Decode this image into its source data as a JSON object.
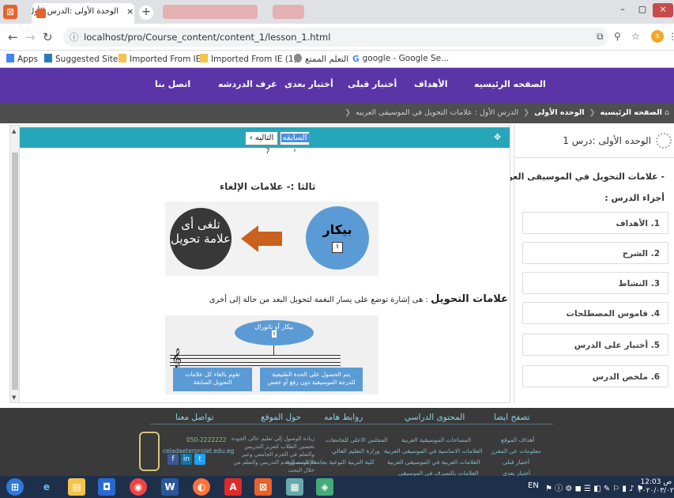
{
  "browser": {
    "tab_title": "الوحدة الأولى :الدرس الأول",
    "url": "localhost/pro/Course_content/content_1/lesson_1.html",
    "bookmarks": [
      "Apps",
      "Suggested Sites",
      "Imported From IE",
      "Imported From IE (1)",
      "التعلم الممتع",
      "google - Google Se..."
    ]
  },
  "site_nav": {
    "items": [
      "الصفحه الرئيسيه",
      "الأهداف",
      "أختبار قبلى",
      "أختبار بعدى",
      "غرف الدردشه",
      "اتصل بنا"
    ]
  },
  "breadcrumb": {
    "home": "الصفحه الرئيسيه",
    "unit": "الوحده الأولى",
    "lesson": "الدرس الأول : علامات التحويل في الموسيقى العربيه"
  },
  "sidebar": {
    "title": "الوحده الأولى :درس 1",
    "lesson_name": "- علامات التحويل في الموسيقى العربية",
    "parts_label": "أجزاء الدرس :",
    "menu": [
      "1. الأهداف",
      "2. الشرح",
      "3. النشاط",
      "4. قاموس المصطلحات",
      "5. أختبار على الدرس",
      "6. ملخص الدرس"
    ]
  },
  "content": {
    "prev_label": "السابقه",
    "next_label": "التاليه",
    "page_number": "7",
    "heading": "ثالثا :- علامات الإلغاء",
    "fig1": {
      "left_text": "تلغى أى علامة تحويل",
      "right_text": "بيكار",
      "natural_sign": "♮"
    },
    "definition_term": "علامات التحويل",
    "definition_text": " : هى إشارة توضع على يسار النغمة لتحويل البعد من حالة إلى أخرى",
    "fig2": {
      "ellipse_text": "بيكار أو ناتورال",
      "box_left": "تقوم بالغاء كل علامات التحويل السابقة",
      "box_right": "يتم الحصول على الحدة الطبيعية للدرجة الموسيقية دون رفع أو خفض"
    }
  },
  "footer": {
    "titles": [
      "تصفح ايضا",
      "المحتوى الدراسي",
      "روابط هامه",
      "حول الموقع",
      "تواصل معنا"
    ],
    "browse_links": [
      "أهداف الموقع",
      "معلومات عن المقرر",
      "أختبار قبلى",
      "أختبار بعدى"
    ],
    "content_links": [
      "المساحات الموسيقية العربية",
      "العلامات الاساسية في الموسيقى العربية",
      "العلامات العربية في الموسيقى العربية",
      "العلامات بالتصرف في الموسيقى"
    ],
    "important_links": [
      "المجلس الاعلى للجامعات",
      "وزارة التعليم العالي",
      "كلية التربية النوعية بجامعة المنصورة"
    ],
    "about_text": "زيادة الوصول إلى تعليم عالي الجودة تحسين الطلاب لتعزيز التدريس والتعلم في الحرم الجامعي وعبر الإنترنت التقدم التدريس والتعلم من خلال البحث",
    "contact_phone": "050-2222222",
    "contact_email": "celadaeterprojet.edu.eg"
  },
  "taskbar": {
    "lang": "EN",
    "time": "12:03",
    "ampm": "ص",
    "date": "٢٠٢٠/٠٣/٠٢"
  }
}
